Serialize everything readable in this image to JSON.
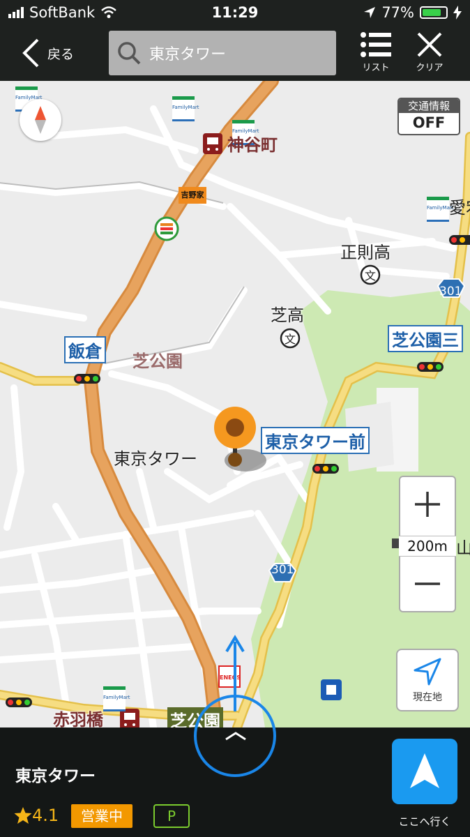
{
  "status_bar": {
    "carrier": "SoftBank",
    "time": "11:29",
    "battery": "77%",
    "battery_level": 0.77
  },
  "header": {
    "back_label": "戻る",
    "search_value": "東京タワー",
    "list_label": "リスト",
    "clear_label": "クリア"
  },
  "map": {
    "traffic_title": "交通情報",
    "traffic_value": "OFF",
    "scale": "200m",
    "current_location_label": "現在地",
    "labels": {
      "kamiyacho": "神谷町",
      "seisoku": "正則高",
      "shiba_high": "芝高",
      "iikura": "飯倉",
      "shibakoen": "芝公園",
      "shibakoen3": "芝公園三",
      "tokyo_tower_mae": "東京タワー前",
      "tokyo_tower": "東京タワー",
      "atago": "愛宕",
      "akabanebashi": "赤羽橋",
      "shibakoen_station": "芝公園",
      "yama": "山",
      "route301a": "301",
      "route301b": "301"
    },
    "brands": {
      "familymart": "FamilyMart",
      "yoshinoya": "吉野家",
      "eneos": "ENEOS"
    }
  },
  "place": {
    "name": "東京タワー",
    "rating": "4.1",
    "status": "営業中",
    "parking": "P",
    "go_label": "ここへ行く"
  },
  "colors": {
    "route_orange": "#e7a35e",
    "road_yellow": "#f2d26a",
    "park_green": "#cde9b3",
    "accent_blue": "#1a9af0",
    "open_orange": "#f39800",
    "parking_green": "#7ccc2e"
  }
}
